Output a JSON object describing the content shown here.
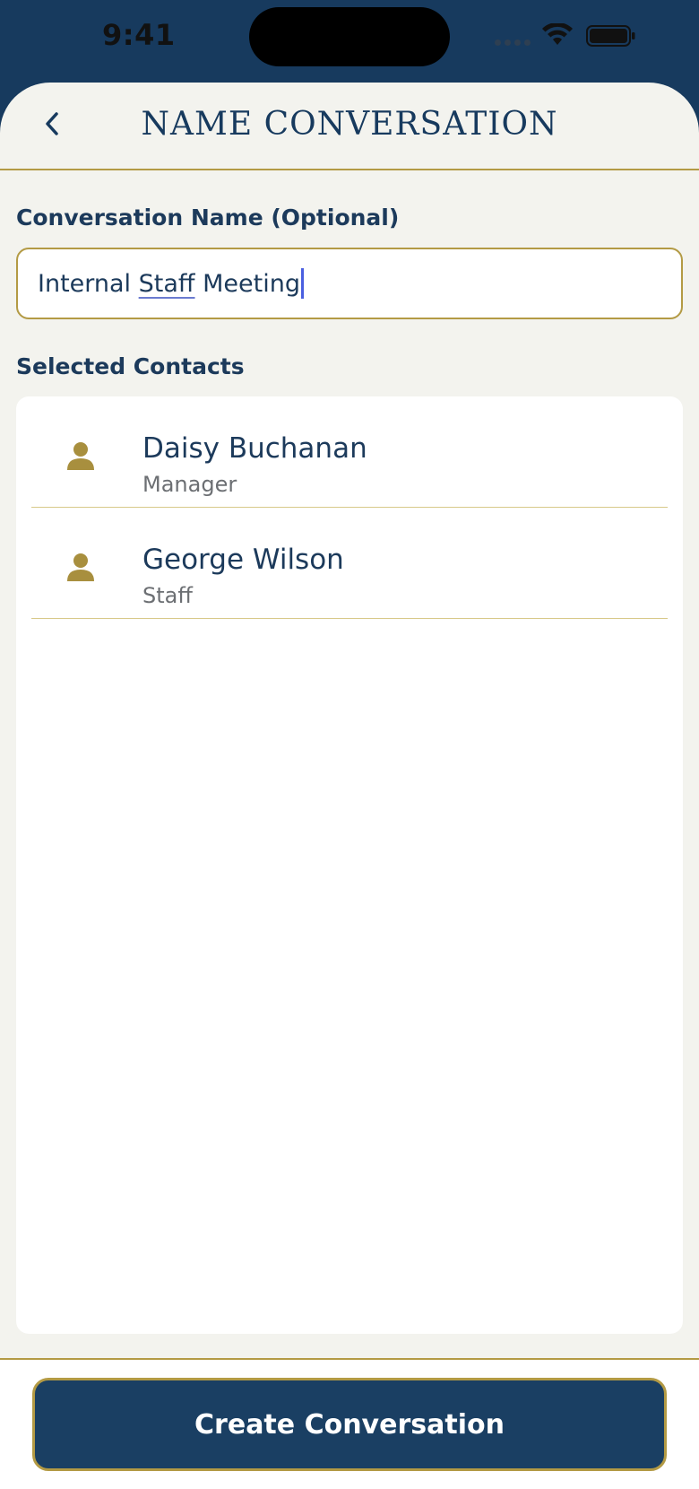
{
  "status_bar": {
    "time": "9:41",
    "icons": [
      "signal-icon",
      "wifi-icon",
      "battery-icon"
    ]
  },
  "nav": {
    "title": "Name Conversation",
    "back_icon": "chevron-left-icon"
  },
  "form": {
    "name_label": "Conversation Name (Optional)",
    "name_value_part1": "Internal ",
    "name_value_part2": "Staff",
    "name_value_part3": " Meeting"
  },
  "contacts": {
    "section_label": "Selected Contacts",
    "items": [
      {
        "name": "Daisy Buchanan",
        "role": "Manager",
        "icon": "person-icon"
      },
      {
        "name": "George Wilson",
        "role": "Staff",
        "icon": "person-icon"
      }
    ]
  },
  "footer": {
    "create_label": "Create Conversation"
  },
  "colors": {
    "navy": "#173a5e",
    "gold": "#b39a44",
    "background": "#f3f3ee"
  }
}
